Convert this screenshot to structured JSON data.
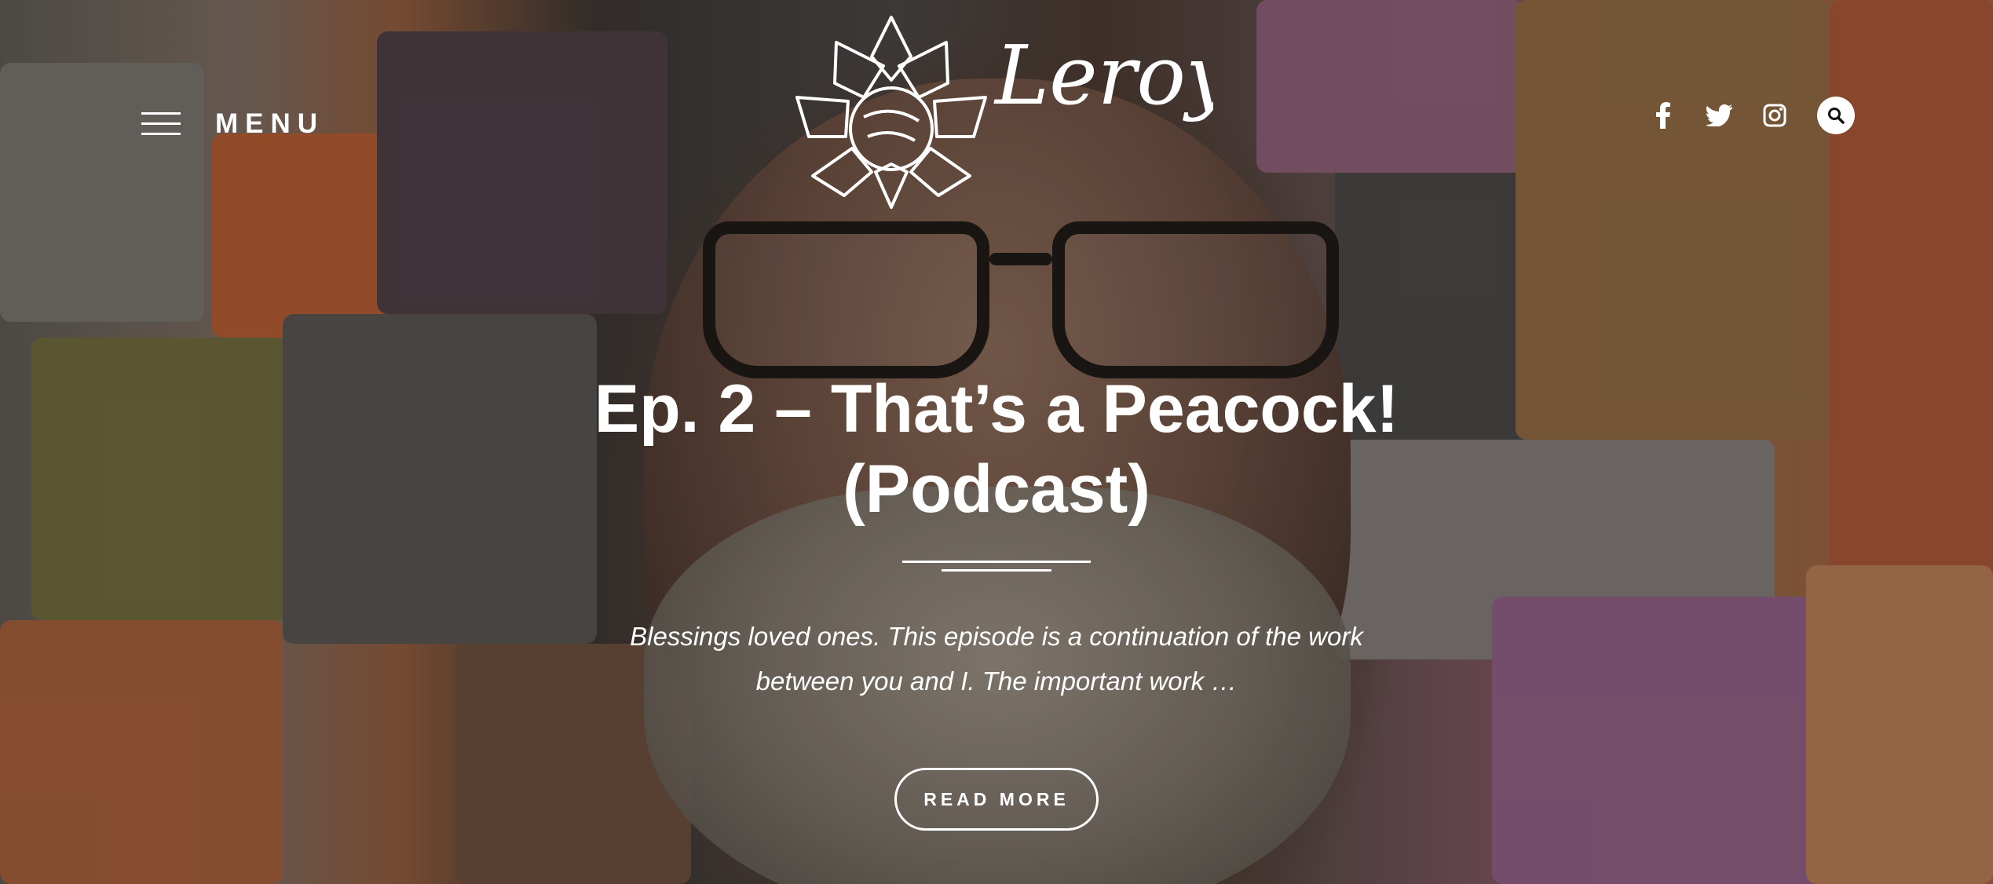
{
  "header": {
    "menu_label": "MENU",
    "logo_text": "Leroy White",
    "social": [
      {
        "icon": "facebook-icon",
        "glyph": "f"
      },
      {
        "icon": "twitter-icon"
      },
      {
        "icon": "instagram-icon"
      }
    ],
    "search_icon": "search-icon"
  },
  "post": {
    "title": "Ep. 2 – That’s a Peacock! (Podcast)",
    "excerpt": "Blessings loved ones. This episode is a continuation of the work between you and I. The important work …",
    "read_more_label": "READ MORE"
  },
  "colors": {
    "text": "#ffffff",
    "button_border": "#ffffff"
  }
}
